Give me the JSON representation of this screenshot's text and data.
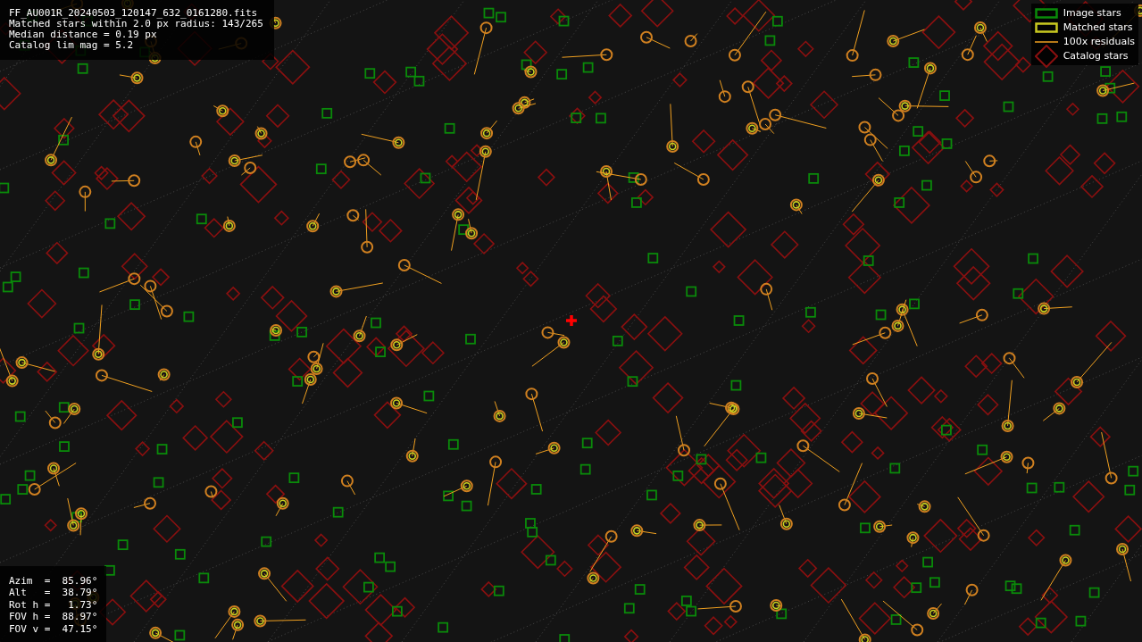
{
  "file_info": {
    "lines": [
      "FF_AU001R_20240503_120147_632_0161280.fits",
      "Matched stars within 2.0 px radius: 143/265",
      "Median distance = 0.19 px",
      "Catalog lim mag = 5.2"
    ]
  },
  "legend": [
    {
      "kind": "image",
      "label": "Image stars"
    },
    {
      "kind": "matched",
      "label": "Matched stars"
    },
    {
      "kind": "residual",
      "label": "100x residuals"
    },
    {
      "kind": "catalog",
      "label": "Catalog stars"
    }
  ],
  "pointing": {
    "lines": [
      "Azim  =  85.96°",
      "Alt   =  38.79°",
      "Rot h =   1.73°",
      "FOV h =  88.97°",
      "FOV v =  47.15°"
    ]
  }
}
